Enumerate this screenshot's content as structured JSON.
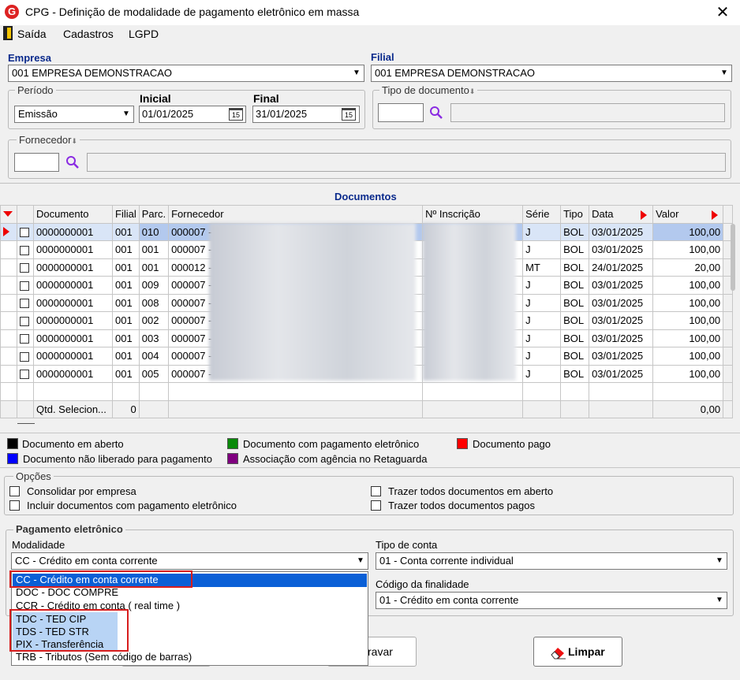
{
  "window": {
    "title": "CPG - Definição de modalidade de pagamento eletrônico em massa",
    "close": "✕",
    "logo": "G"
  },
  "menu": {
    "exit": "Saída",
    "cadastros": "Cadastros",
    "lgpd": "LGPD"
  },
  "empresa": {
    "label": "Empresa",
    "value": "001 EMPRESA DEMONSTRACAO"
  },
  "filial": {
    "label": "Filial",
    "value": "001 EMPRESA DEMONSTRACAO"
  },
  "periodo": {
    "label": "Período",
    "type": "Emissão",
    "initial_label": "Inicial",
    "initial": "01/01/2025",
    "final_label": "Final",
    "final": "31/01/2025",
    "cal": "15"
  },
  "tipo_documento": {
    "label": "Tipo de documento"
  },
  "fornecedor": {
    "label": "Fornecedor"
  },
  "documentos": {
    "title": "Documentos",
    "headers": [
      "Documento",
      "Filial",
      "Parc.",
      "Fornecedor",
      "Nº Inscrição",
      "Série",
      "Tipo",
      "Data",
      "Valor"
    ],
    "rows": [
      {
        "doc": "0000000001",
        "filial": "001",
        "parc": "010",
        "forn": "000007 -",
        "serie": "J",
        "tipo": "BOL",
        "data": "03/01/2025",
        "valor": "100,00"
      },
      {
        "doc": "0000000001",
        "filial": "001",
        "parc": "001",
        "forn": "000007 -",
        "serie": "J",
        "tipo": "BOL",
        "data": "03/01/2025",
        "valor": "100,00"
      },
      {
        "doc": "0000000001",
        "filial": "001",
        "parc": "001",
        "forn": "000012 -",
        "serie": "MT",
        "tipo": "BOL",
        "data": "24/01/2025",
        "valor": "20,00"
      },
      {
        "doc": "0000000001",
        "filial": "001",
        "parc": "009",
        "forn": "000007 -",
        "serie": "J",
        "tipo": "BOL",
        "data": "03/01/2025",
        "valor": "100,00"
      },
      {
        "doc": "0000000001",
        "filial": "001",
        "parc": "008",
        "forn": "000007 -",
        "serie": "J",
        "tipo": "BOL",
        "data": "03/01/2025",
        "valor": "100,00"
      },
      {
        "doc": "0000000001",
        "filial": "001",
        "parc": "002",
        "forn": "000007 -",
        "serie": "J",
        "tipo": "BOL",
        "data": "03/01/2025",
        "valor": "100,00"
      },
      {
        "doc": "0000000001",
        "filial": "001",
        "parc": "003",
        "forn": "000007 -",
        "serie": "J",
        "tipo": "BOL",
        "data": "03/01/2025",
        "valor": "100,00"
      },
      {
        "doc": "0000000001",
        "filial": "001",
        "parc": "004",
        "forn": "000007 -",
        "serie": "J",
        "tipo": "BOL",
        "data": "03/01/2025",
        "valor": "100,00"
      },
      {
        "doc": "0000000001",
        "filial": "001",
        "parc": "005",
        "forn": "000007 -",
        "serie": "J",
        "tipo": "BOL",
        "data": "03/01/2025",
        "valor": "100,00"
      }
    ],
    "footer_label": "Qtd. Selecion...",
    "footer_count": "0",
    "footer_total": "0,00"
  },
  "legend": [
    {
      "label": "Documento em aberto",
      "color": "#000000"
    },
    {
      "label": "Documento com pagamento eletrônico",
      "color": "#0a8a0a"
    },
    {
      "label": "Documento pago",
      "color": "#ff0000"
    },
    {
      "label": "Documento não liberado para pagamento",
      "color": "#0000ff"
    },
    {
      "label": "Associação com agência no Retaguarda",
      "color": "#800080"
    }
  ],
  "opcoes": {
    "title": "Opções",
    "consolidar": "Consolidar por empresa",
    "incluir": "Incluir documentos com pagamento eletrônico",
    "trazer_aberto": "Trazer todos documentos em aberto",
    "trazer_pagos": "Trazer todos documentos pagos"
  },
  "pagamento": {
    "title": "Pagamento eletrônico",
    "modalidade_label": "Modalidade",
    "modalidade_value": "CC   - Crédito em conta corrente",
    "tipo_conta_label": "Tipo de conta",
    "tipo_conta_value": "01 - Conta corrente individual",
    "finalidade_label": "Código da finalidade",
    "finalidade_value": "01 - Crédito em conta corrente",
    "options": [
      "CC   - Crédito em conta corrente",
      "DOC - DOC COMPRE",
      "CCR - Crédito em conta ( real time )",
      "TDC - TED CIP",
      "TDS - TED STR",
      "PIX - Transferência",
      "TRB - Tributos (Sem código de barras)"
    ]
  },
  "buttons": {
    "gravar": "Gravar",
    "gravar_visible": "ravar",
    "limpar": "Limpar"
  },
  "colors": {
    "accent_blue": "#0a2a8c",
    "highlight_red": "#d81d1d",
    "selected_row": "#b3c9ee"
  }
}
